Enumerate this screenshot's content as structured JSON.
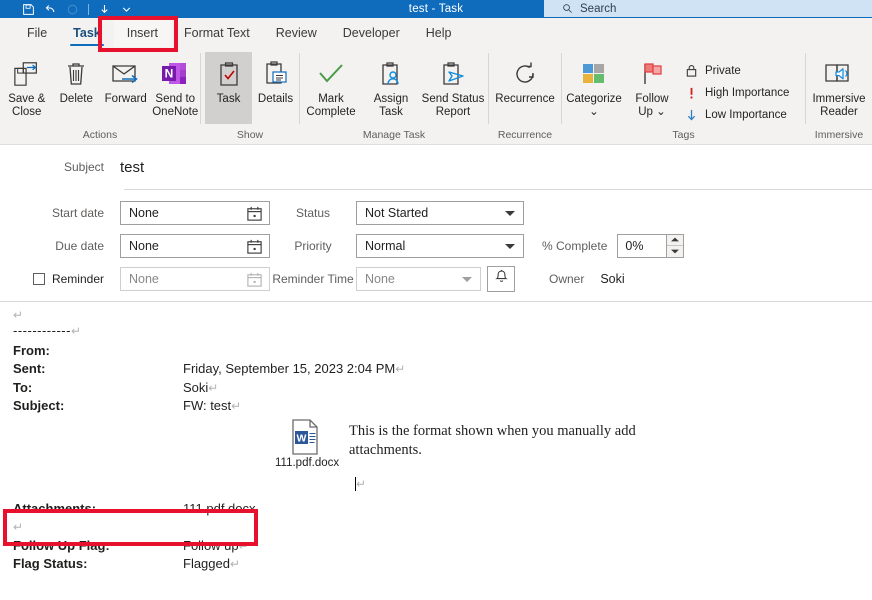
{
  "window": {
    "title": "test  -  Task",
    "qat": [
      "save-icon",
      "undo-icon",
      "redo-icon",
      "separator",
      "touch-mode-icon",
      "customize-chevron-icon"
    ]
  },
  "search": {
    "placeholder": "Search",
    "icon": "search-icon"
  },
  "tabs": [
    {
      "label": "File",
      "state": "normal"
    },
    {
      "label": "Task",
      "state": "active"
    },
    {
      "label": "Insert",
      "state": "highlighted"
    },
    {
      "label": "Format Text",
      "state": "normal"
    },
    {
      "label": "Review",
      "state": "normal"
    },
    {
      "label": "Developer",
      "state": "normal"
    },
    {
      "label": "Help",
      "state": "normal"
    }
  ],
  "ribbon": {
    "groups": [
      {
        "name": "Actions",
        "buttons": [
          {
            "label": "Save &\nClose",
            "icon": "save-and-close-icon"
          },
          {
            "label": "Delete",
            "icon": "trash-icon"
          },
          {
            "label": "Forward",
            "icon": "forward-envelope-icon"
          },
          {
            "label": "Send to\nOneNote",
            "icon": "onenote-icon"
          }
        ]
      },
      {
        "name": "Show",
        "buttons": [
          {
            "label": "Task",
            "icon": "clipboard-check-icon",
            "selected": true
          },
          {
            "label": "Details",
            "icon": "clipboard-details-icon"
          }
        ]
      },
      {
        "name": "Manage Task",
        "buttons": [
          {
            "label": "Mark\nComplete",
            "icon": "checkmark-icon"
          },
          {
            "label": "Assign\nTask",
            "icon": "clipboard-person-icon"
          },
          {
            "label": "Send Status\nReport",
            "icon": "clipboard-send-icon"
          }
        ]
      },
      {
        "name": "Recurrence",
        "buttons": [
          {
            "label": "Recurrence",
            "icon": "recurrence-circular-arrows-icon"
          }
        ]
      },
      {
        "name": "Tags",
        "buttons": [
          {
            "label": "Categorize\n⌄",
            "icon": "categorize-squares-icon"
          },
          {
            "label": "Follow\nUp ⌄",
            "icon": "follow-up-flag-icon"
          }
        ],
        "small_buttons": [
          {
            "label": "Private",
            "icon": "lock-icon"
          },
          {
            "label": "High Importance",
            "icon": "exclamation-icon"
          },
          {
            "label": "Low Importance",
            "icon": "down-arrow-icon"
          }
        ]
      },
      {
        "name": "Immersive",
        "buttons": [
          {
            "label": "Immersive\nReader",
            "icon": "immersive-reader-book-icon"
          }
        ]
      }
    ]
  },
  "form": {
    "subject_label": "Subject",
    "subject_value": "test",
    "start_date_label": "Start date",
    "start_date_value": "None",
    "due_date_label": "Due date",
    "due_date_value": "None",
    "reminder_label": "Reminder",
    "reminder_value": "None",
    "reminder_checked": false,
    "status_label": "Status",
    "status_value": "Not Started",
    "priority_label": "Priority",
    "priority_value": "Normal",
    "reminder_time_label": "Reminder Time",
    "reminder_time_value": "None",
    "percent_complete_label": "% Complete",
    "percent_complete_value": "0%",
    "owner_label": "Owner",
    "owner_value": "Soki",
    "bell_icon": "bell-icon",
    "calendar_icon": "calendar-icon"
  },
  "body": {
    "pilcrow": "↵",
    "separator_line": "------------",
    "headers": [
      {
        "key": "From:",
        "value": ""
      },
      {
        "key": "Sent:",
        "value": "Friday, September 15, 2023 2:04 PM"
      },
      {
        "key": "To:",
        "value": "Soki"
      },
      {
        "key": "Subject:",
        "value": "FW: test"
      }
    ],
    "attachment": {
      "icon": "word-document-icon",
      "filename": "111.pdf.docx"
    },
    "paragraph": "This is the format shown when you manually add attachments.",
    "footers": [
      {
        "key": "Attachments:",
        "value": "111.pdf.docx",
        "highlighted": true
      },
      {
        "key": "Follow Up Flag:",
        "value": "Follow up"
      },
      {
        "key": "Flag Status:",
        "value": "Flagged"
      }
    ]
  },
  "annotations": {
    "color": "#e8112d",
    "boxes": [
      {
        "target": "insert-tab"
      },
      {
        "target": "attachments-row"
      }
    ]
  }
}
